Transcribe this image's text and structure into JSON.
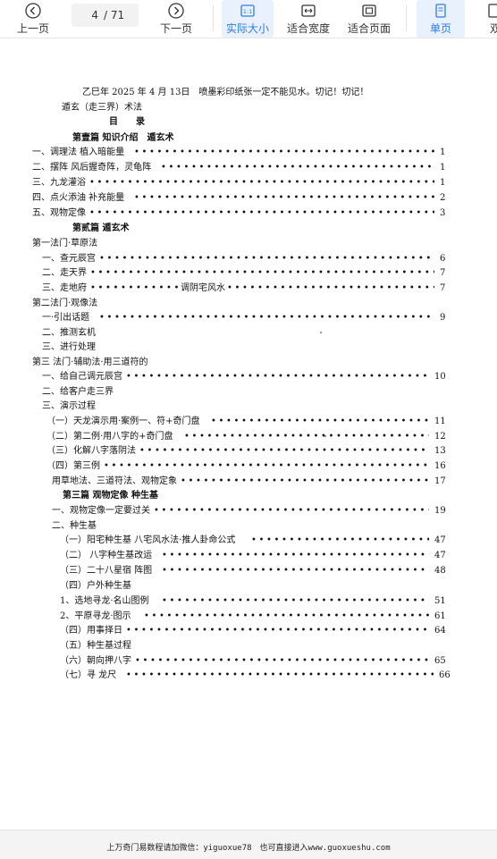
{
  "toolbar": {
    "prev_label": "上一页",
    "next_label": "下一页",
    "page_current": "4",
    "page_total": "/ 71",
    "actual_size_label": "实际大小",
    "fit_width_label": "适合宽度",
    "fit_page_label": "适合页面",
    "single_page_label": "单页",
    "cut_label": "双"
  },
  "doc": {
    "header_note": "乙巳年 2025 年 4 月 13日　喷墨彩印纸张一定不能见水。切记！切记！",
    "subtitle": "遁玄（走三界）术法",
    "contents_title": "目　　录",
    "toc": [
      {
        "kind": "heading",
        "text": "第壹篇 知识介绍　遁玄术"
      },
      {
        "kind": "entry",
        "text": "一、调理法 植入暗能量",
        "page": "1"
      },
      {
        "kind": "entry",
        "text": "二、摆阵 风后握奇阵，灵龟阵",
        "page": "1"
      },
      {
        "kind": "entry",
        "text": "三、九龙灌浴",
        "page": "1"
      },
      {
        "kind": "entry",
        "text": "四、点火添油 补充能量",
        "page": "2"
      },
      {
        "kind": "entry",
        "text": "五、观物定像",
        "page": "3"
      },
      {
        "kind": "heading",
        "text": "第贰篇 遁玄术"
      },
      {
        "kind": "plain",
        "text": "第一法门·草原法"
      },
      {
        "kind": "entry",
        "text": "一、查元辰宫",
        "page": "6"
      },
      {
        "kind": "entry",
        "text": "二、走天界",
        "page": "7"
      },
      {
        "kind": "entry",
        "text": "三、走地府",
        "mid": "调阴宅风水",
        "page": "7"
      },
      {
        "kind": "plain",
        "text": "第二法门·观像法"
      },
      {
        "kind": "entry",
        "text": "一·引出话题",
        "page": "9"
      },
      {
        "kind": "plain",
        "text": "二、推测玄机"
      },
      {
        "kind": "plain",
        "text": "三、进行处理"
      },
      {
        "kind": "plain",
        "text": "第三 法门·辅助法·用三道符的"
      },
      {
        "kind": "entry",
        "text": "一、给自己调元辰宫",
        "page": "10"
      },
      {
        "kind": "plain",
        "text": "二、给客户走三界"
      },
      {
        "kind": "plain",
        "text": "三、演示过程"
      },
      {
        "kind": "entry",
        "text": "（一）天龙演示用·案例一、符+奇门盘",
        "page": "11"
      },
      {
        "kind": "entry",
        "text": "（二）第二例·用八字的+奇门盘",
        "page": "12"
      },
      {
        "kind": "entry",
        "text": "（三）化解八字落阴法",
        "page": "13"
      },
      {
        "kind": "entry",
        "text": "（四）第三例",
        "page": "16"
      },
      {
        "kind": "entry",
        "text": "用草地法、三道符法、观物定象",
        "page": "17"
      },
      {
        "kind": "heading",
        "text": "第三篇 观物定像 种生基"
      },
      {
        "kind": "entry",
        "text": "一、观物定像一定要过关",
        "page": "19"
      },
      {
        "kind": "plain",
        "text": "二、种生基"
      },
      {
        "kind": "entry",
        "text": "（一）阳宅种生基 八宅风水法·推人卦命公式",
        "page": "47"
      },
      {
        "kind": "entry",
        "text": "（二） 八字种生基改运",
        "page": "47"
      },
      {
        "kind": "entry",
        "text": "（三）二十八星宿 阵图",
        "page": "48"
      },
      {
        "kind": "plain",
        "text": "（四）户外种生基"
      },
      {
        "kind": "entry",
        "text": "1、选地寻龙·名山图例",
        "page": "51"
      },
      {
        "kind": "entry",
        "text": "2、平原寻龙·图示",
        "page": "61"
      },
      {
        "kind": "entry",
        "text": "（四）用事择日",
        "page": "64"
      },
      {
        "kind": "plain",
        "text": "（五）种生基过程"
      },
      {
        "kind": "entry",
        "text": "（六）朝向押八字",
        "page": "65"
      },
      {
        "kind": "entry",
        "text": "（七）寻 龙尺",
        "page": "66"
      }
    ]
  },
  "footer": {
    "text": "上万奇门易数程请加微信：yiguoxue78　也可直接进入www.guoxueshu.com"
  }
}
